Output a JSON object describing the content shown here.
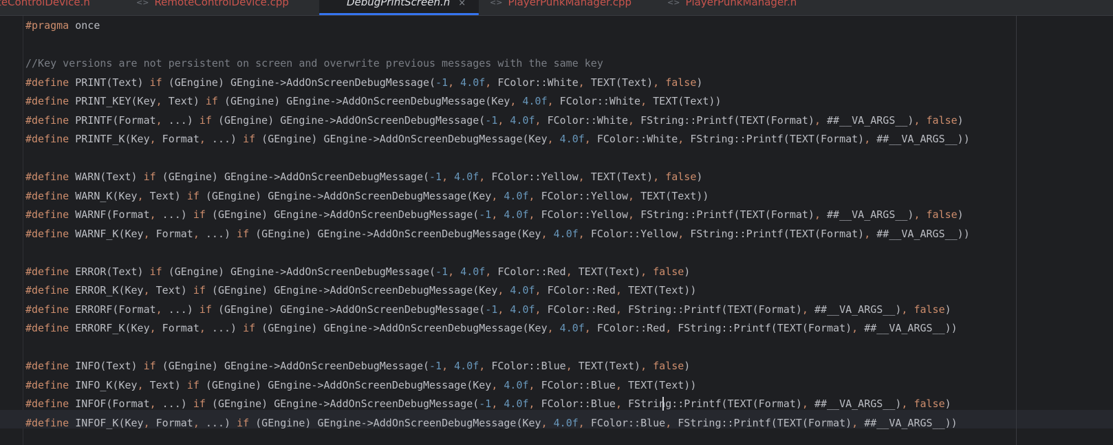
{
  "tabs": [
    {
      "label": "teControlDevice.h",
      "active": false
    },
    {
      "label": "RemoteControlDevice.cpp",
      "active": false
    },
    {
      "label": "DebugPrintScreen.h",
      "active": true
    },
    {
      "label": "PlayerPunkManager.cpp",
      "active": false
    },
    {
      "label": "PlayerPunkManager.h",
      "active": false
    }
  ],
  "tab_icons": {
    "close": "×",
    "file_icon": "c++-file-icon"
  },
  "colors": {
    "background": "#1e1f22",
    "directive": "#cf8e6d",
    "comment": "#7a7e85",
    "number": "#6897bb",
    "text": "#bcbec4",
    "accent": "#3574f0"
  },
  "code_lines": [
    "#pragma once",
    "",
    "//Key versions are not persistent on screen and overwrite previous messages with the same key",
    "#define PRINT(Text) if (GEngine) GEngine->AddOnScreenDebugMessage(-1, 4.0f, FColor::White, TEXT(Text), false)",
    "#define PRINT_KEY(Key, Text) if (GEngine) GEngine->AddOnScreenDebugMessage(Key, 4.0f, FColor::White, TEXT(Text))",
    "#define PRINTF(Format, ...) if (GEngine) GEngine->AddOnScreenDebugMessage(-1, 4.0f, FColor::White, FString::Printf(TEXT(Format), ##__VA_ARGS__), false)",
    "#define PRINTF_K(Key, Format, ...) if (GEngine) GEngine->AddOnScreenDebugMessage(Key, 4.0f, FColor::White, FString::Printf(TEXT(Format), ##__VA_ARGS__))",
    "",
    "#define WARN(Text) if (GEngine) GEngine->AddOnScreenDebugMessage(-1, 4.0f, FColor::Yellow, TEXT(Text), false)",
    "#define WARN_K(Key, Text) if (GEngine) GEngine->AddOnScreenDebugMessage(Key, 4.0f, FColor::Yellow, TEXT(Text))",
    "#define WARNF(Format, ...) if (GEngine) GEngine->AddOnScreenDebugMessage(-1, 4.0f, FColor::Yellow, FString::Printf(TEXT(Format), ##__VA_ARGS__), false)",
    "#define WARNF_K(Key, Format, ...) if (GEngine) GEngine->AddOnScreenDebugMessage(Key, 4.0f, FColor::Yellow, FString::Printf(TEXT(Format), ##__VA_ARGS__))",
    "",
    "#define ERROR(Text) if (GEngine) GEngine->AddOnScreenDebugMessage(-1, 4.0f, FColor::Red, TEXT(Text), false)",
    "#define ERROR_K(Key, Text) if (GEngine) GEngine->AddOnScreenDebugMessage(Key, 4.0f, FColor::Red, TEXT(Text))",
    "#define ERRORF(Format, ...) if (GEngine) GEngine->AddOnScreenDebugMessage(-1, 4.0f, FColor::Red, FString::Printf(TEXT(Format), ##__VA_ARGS__), false)",
    "#define ERRORF_K(Key, Format, ...) if (GEngine) GEngine->AddOnScreenDebugMessage(Key, 4.0f, FColor::Red, FString::Printf(TEXT(Format), ##__VA_ARGS__))",
    "",
    "#define INFO(Text) if (GEngine) GEngine->AddOnScreenDebugMessage(-1, 4.0f, FColor::Blue, TEXT(Text), false)",
    "#define INFO_K(Key, Text) if (GEngine) GEngine->AddOnScreenDebugMessage(Key, 4.0f, FColor::Blue, TEXT(Text))",
    "#define INFOF(Format, ...) if (GEngine) GEngine->AddOnScreenDebugMessage(-1, 4.0f, FColor::Blue, FString::Printf(TEXT(Format), ##__VA_ARGS__), false)",
    "#define INFOF_K(Key, Format, ...) if (GEngine) GEngine->AddOnScreenDebugMessage(Key, 4.0f, FColor::Blue, FString::Printf(TEXT(Format), ##__VA_ARGS__))"
  ]
}
